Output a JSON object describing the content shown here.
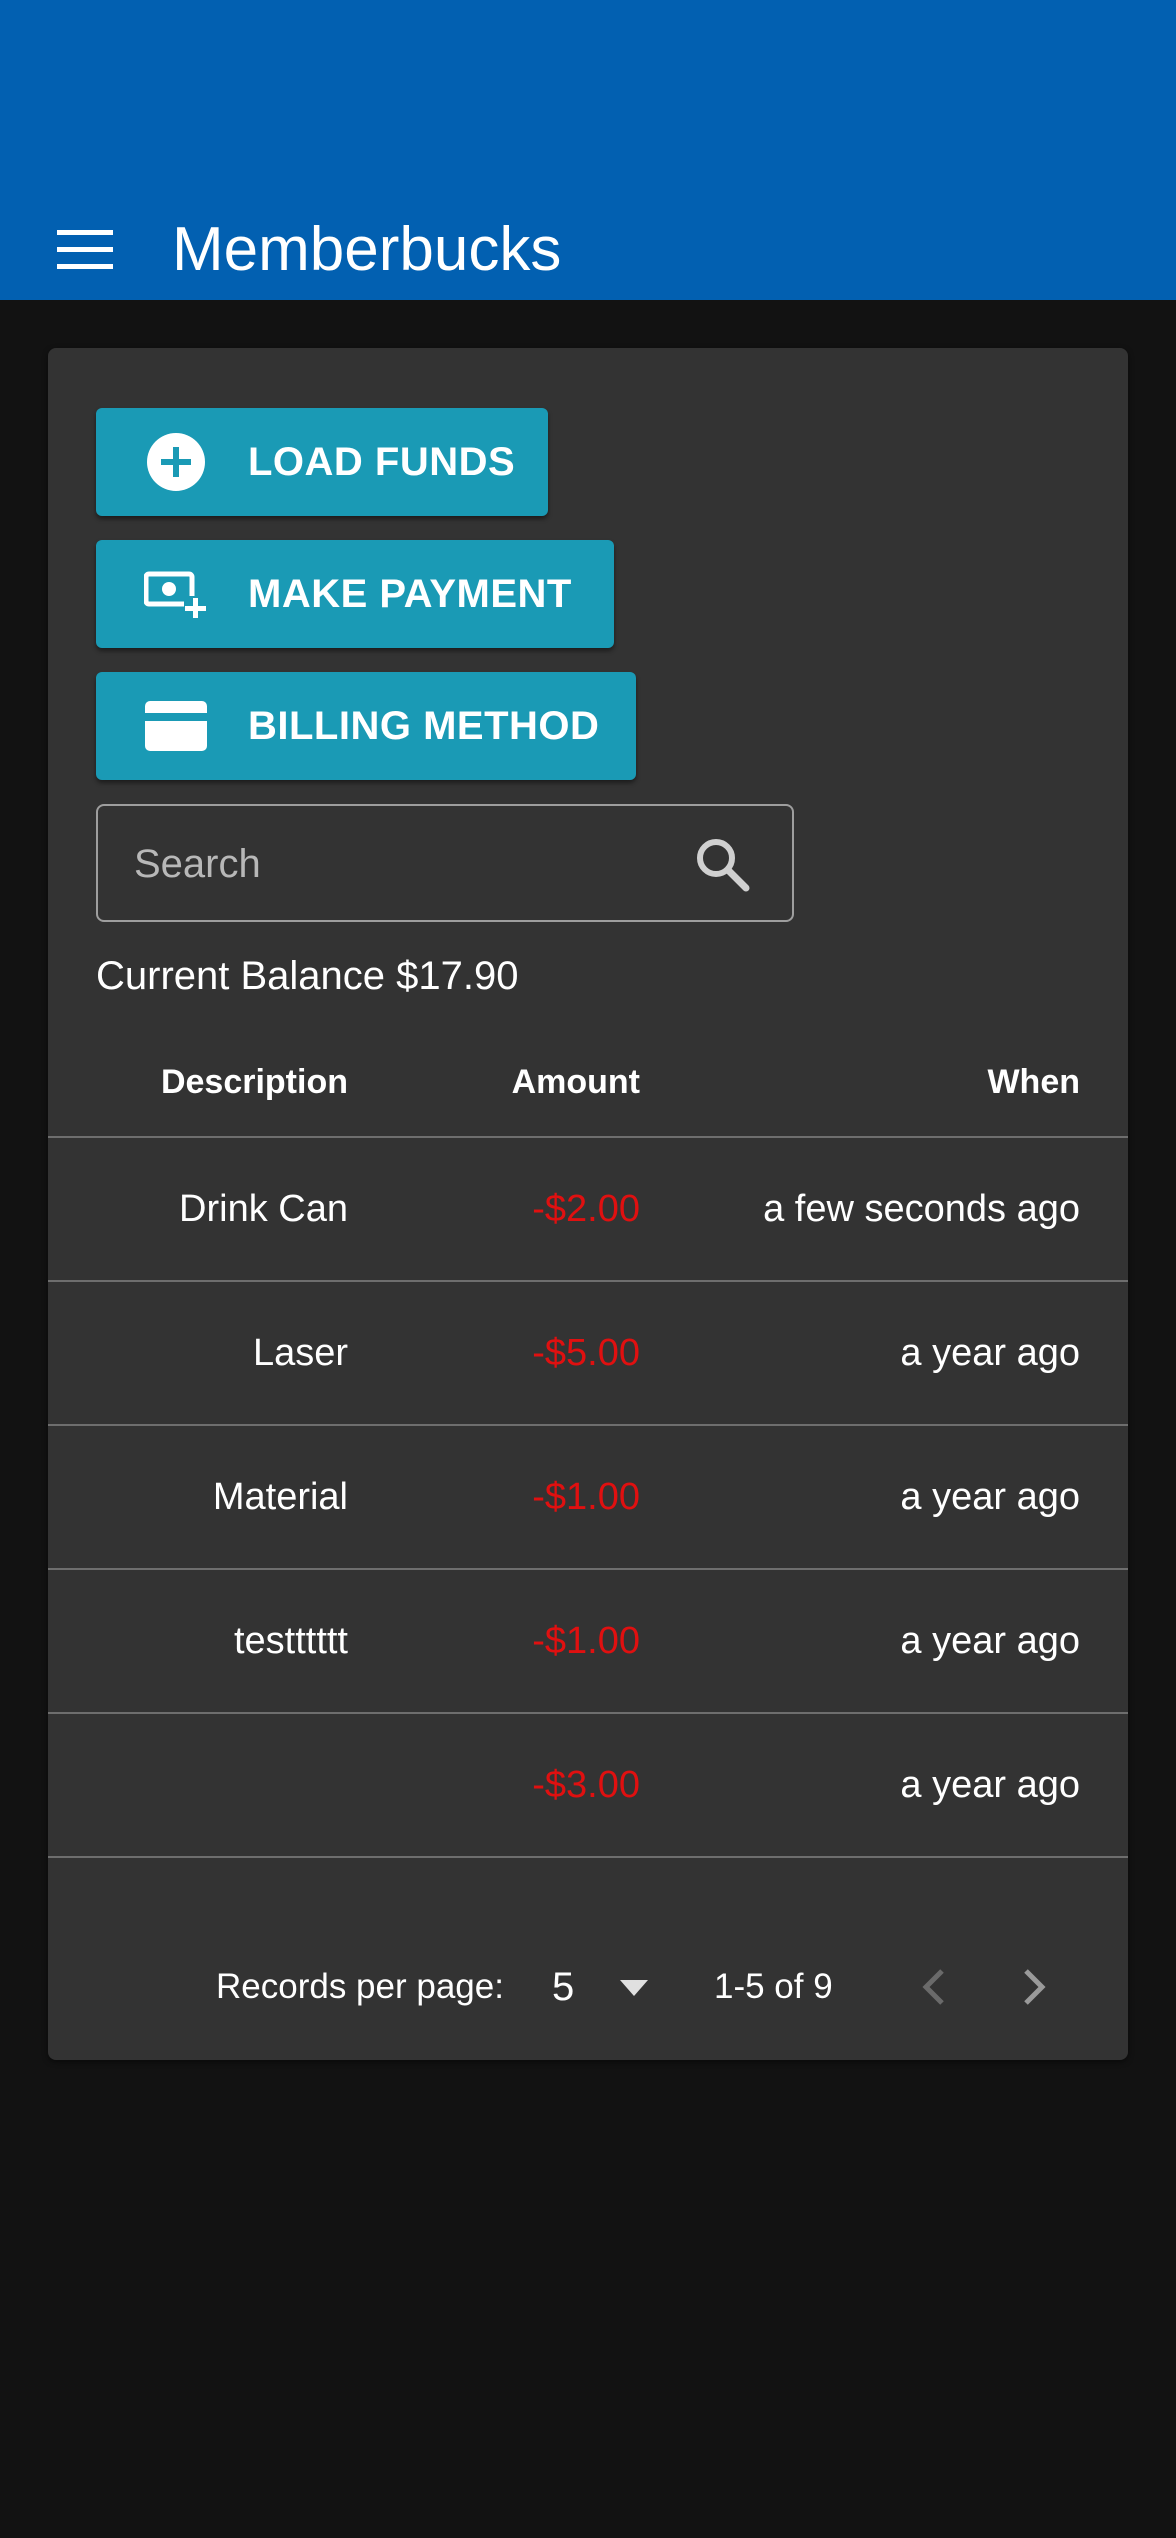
{
  "app_bar": {
    "title": "Memberbucks",
    "color": "#0260b1",
    "menu_icon": "menu-icon"
  },
  "actions": {
    "load_funds": {
      "label": "LOAD FUNDS",
      "icon": "plus-circle-icon"
    },
    "make_payment": {
      "label": "MAKE PAYMENT",
      "icon": "cash-plus-icon"
    },
    "billing_method": {
      "label": "BILLING METHOD",
      "icon": "credit-card-icon"
    },
    "button_color": "#1a9ab5"
  },
  "search": {
    "placeholder": "Search",
    "value": "",
    "icon": "search-icon"
  },
  "balance": {
    "text": "Current Balance $17.90"
  },
  "table": {
    "columns": [
      "Description",
      "Amount",
      "When"
    ],
    "rows": [
      {
        "description": "Drink Can",
        "amount": "-$2.00",
        "when": "a few seconds ago"
      },
      {
        "description": "Laser",
        "amount": "-$5.00",
        "when": "a year ago"
      },
      {
        "description": "Material",
        "amount": "-$1.00",
        "when": "a year ago"
      },
      {
        "description": "testttttt",
        "amount": "-$1.00",
        "when": "a year ago"
      },
      {
        "description": "",
        "amount": "-$3.00",
        "when": "a year ago"
      }
    ],
    "negative_amount_color": "#e01010"
  },
  "pagination": {
    "records_per_page_label": "Records per page:",
    "records_per_page": "5",
    "range": "1-5 of 9",
    "prev_icon": "chevron-left-icon",
    "next_icon": "chevron-right-icon"
  }
}
